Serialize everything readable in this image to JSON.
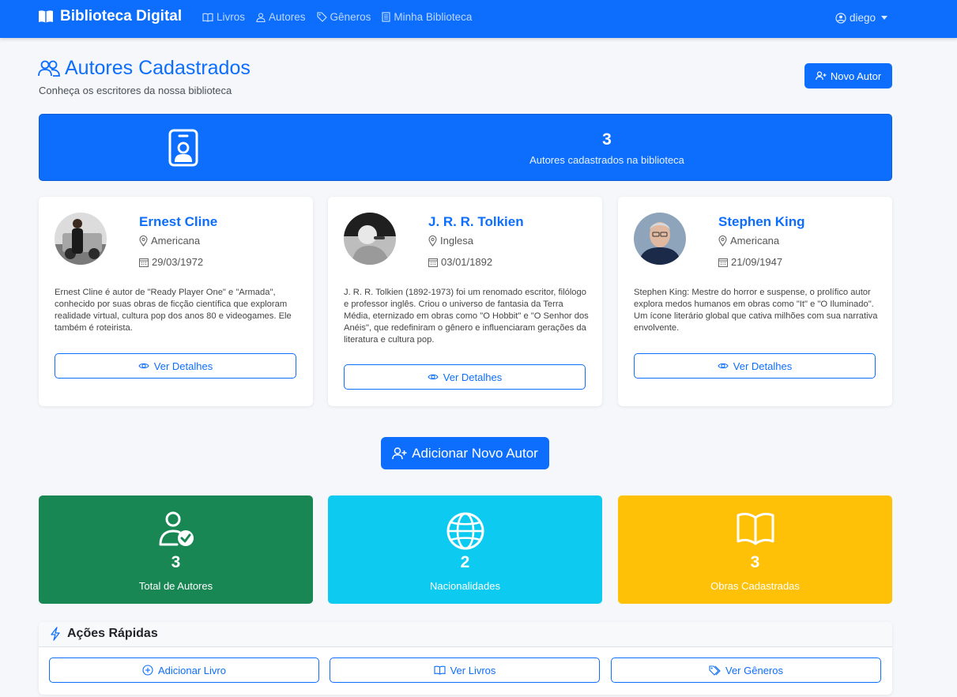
{
  "nav": {
    "brand": "Biblioteca Digital",
    "links": [
      {
        "label": "Livros",
        "icon": "book-icon"
      },
      {
        "label": "Autores",
        "icon": "person-icon"
      },
      {
        "label": "Gêneros",
        "icon": "tags-icon"
      },
      {
        "label": "Minha Biblioteca",
        "icon": "list-icon"
      }
    ],
    "user": "diego"
  },
  "header": {
    "title": "Autores Cadastrados",
    "subtitle": "Conheça os escritores da nossa biblioteca",
    "new_author_label": "Novo Autor"
  },
  "banner": {
    "count": "3",
    "label": "Autores cadastrados na biblioteca"
  },
  "authors": [
    {
      "name": "Ernest Cline",
      "nationality": "Americana",
      "birth_date": "29/03/1972",
      "bio": "Ernest Cline é autor de \"Ready Player One\" e \"Armada\", conhecido por suas obras de ficção científica que exploram realidade virtual, cultura pop dos anos 80 e videogames. Ele também é roteirista.",
      "button_label": "Ver Detalhes"
    },
    {
      "name": "J. R. R. Tolkien",
      "nationality": "Inglesa",
      "birth_date": "03/01/1892",
      "bio": "J. R. R. Tolkien (1892-1973) foi um renomado escritor, filólogo e professor inglês. Criou o universo de fantasia da Terra Média, eternizado em obras como \"O Hobbit\" e \"O Senhor dos Anéis\", que redefiniram o gênero e influenciaram gerações da literatura e cultura pop.",
      "button_label": "Ver Detalhes"
    },
    {
      "name": "Stephen King",
      "nationality": "Americana",
      "birth_date": "21/09/1947",
      "bio": "Stephen King: Mestre do horror e suspense, o prolífico autor explora medos humanos em obras como \"It\" e \"O Iluminado\". Um ícone literário global que cativa milhões com sua narrativa envolvente.",
      "button_label": "Ver Detalhes"
    }
  ],
  "add_author_label": "Adicionar Novo Autor",
  "stats": [
    {
      "value": "3",
      "label": "Total de Autores",
      "color": "#198754",
      "icon": "person-check-icon"
    },
    {
      "value": "2",
      "label": "Nacionalidades",
      "color": "#0dcaf0",
      "icon": "globe-icon"
    },
    {
      "value": "3",
      "label": "Obras Cadastradas",
      "color": "#ffc107",
      "icon": "book-open-icon"
    }
  ],
  "quick_actions": {
    "title": "Ações Rápidas",
    "buttons": [
      {
        "label": "Adicionar Livro",
        "icon": "plus-circle-icon"
      },
      {
        "label": "Ver Livros",
        "icon": "book-icon"
      },
      {
        "label": "Ver Gêneros",
        "icon": "tags-icon"
      }
    ]
  },
  "colors": {
    "primary": "#0d6efd",
    "success": "#198754",
    "info": "#0dcaf0",
    "warning": "#ffc107"
  }
}
